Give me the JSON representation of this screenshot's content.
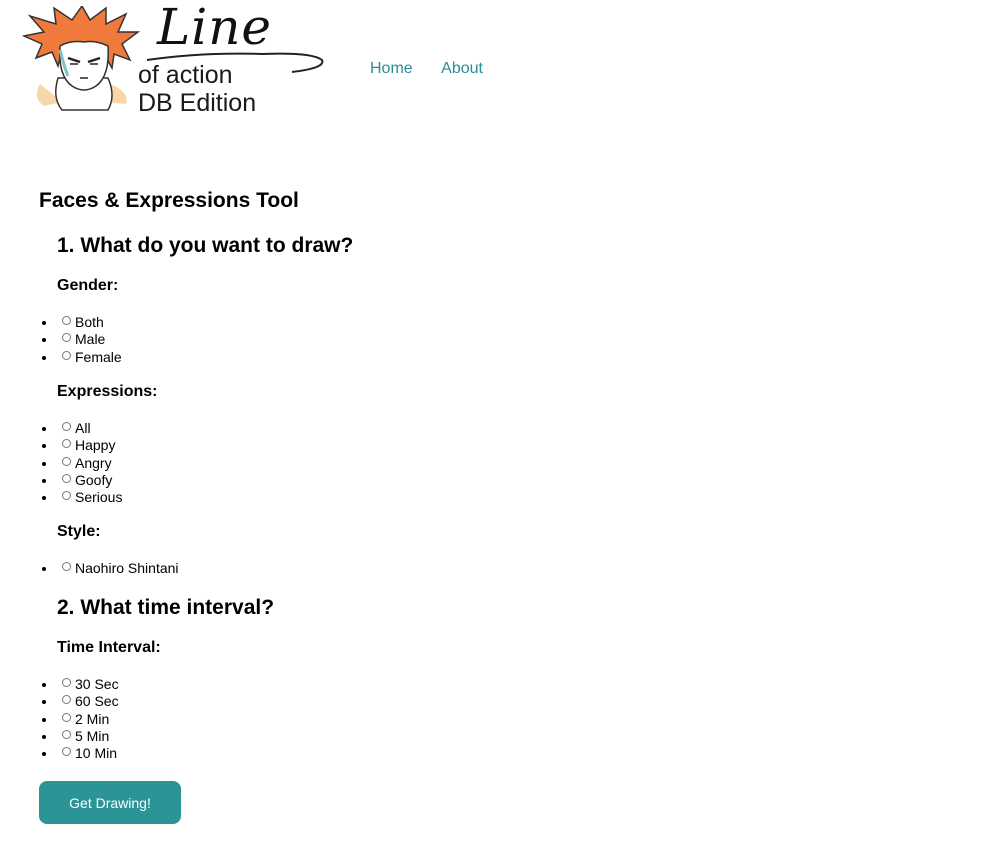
{
  "logo": {
    "line1": "Line",
    "line2": "of action",
    "line3": "DB Edition"
  },
  "nav": {
    "items": [
      "Home",
      "About"
    ]
  },
  "page_title": "Faces & Expressions Tool",
  "section1": {
    "title": "1. What do you want to draw?",
    "gender": {
      "label": "Gender:",
      "options": [
        "Both",
        "Male",
        "Female"
      ]
    },
    "expressions": {
      "label": "Expressions:",
      "options": [
        "All",
        "Happy",
        "Angry",
        "Goofy",
        "Serious"
      ]
    },
    "style": {
      "label": "Style:",
      "options": [
        "Naohiro Shintani"
      ]
    }
  },
  "section2": {
    "title": "2. What time interval?",
    "interval": {
      "label": "Time Interval:",
      "options": [
        "30 Sec",
        "60 Sec",
        "2 Min",
        "5 Min",
        "10 Min"
      ]
    }
  },
  "submit_label": "Get Drawing!",
  "colors": {
    "accent": "#2b9496",
    "nav_link": "#2b8e91",
    "logo_hair": "#f07a3c"
  }
}
